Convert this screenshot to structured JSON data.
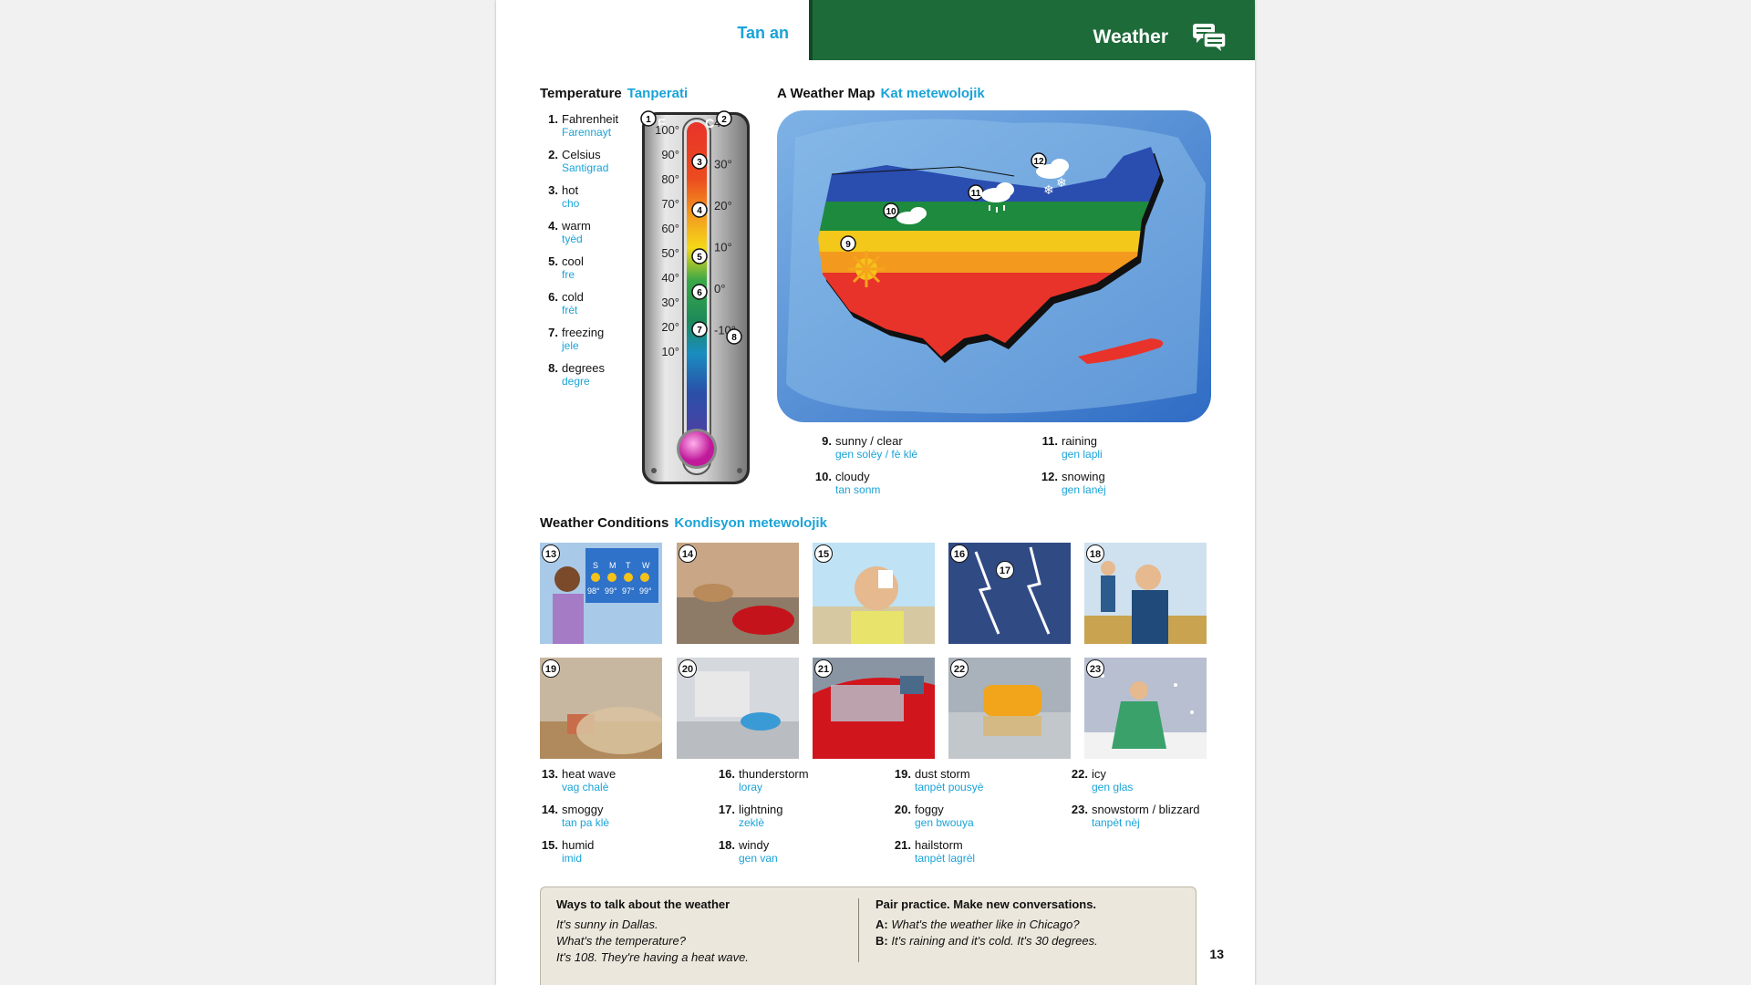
{
  "header": {
    "left_title": "Tan an",
    "right_title": "Weather",
    "icon": "speech-bubble-icon"
  },
  "temperature": {
    "title": "Temperature",
    "title_ht": "Tanperati",
    "items": [
      {
        "num": "1.",
        "en": "Fahrenheit",
        "ht": "Farennayt"
      },
      {
        "num": "2.",
        "en": "Celsius",
        "ht": "Santigrad"
      },
      {
        "num": "3.",
        "en": "hot",
        "ht": "cho"
      },
      {
        "num": "4.",
        "en": "warm",
        "ht": "tyèd"
      },
      {
        "num": "5.",
        "en": "cool",
        "ht": "fre"
      },
      {
        "num": "6.",
        "en": "cold",
        "ht": "frèt"
      },
      {
        "num": "7.",
        "en": "freezing",
        "ht": "jele"
      },
      {
        "num": "8.",
        "en": "degrees",
        "ht": "degre"
      }
    ],
    "thermometer": {
      "f_label": "F",
      "c_label": "C",
      "f_ticks": [
        "100°",
        "90°",
        "80°",
        "70°",
        "60°",
        "50°",
        "40°",
        "30°",
        "20°",
        "10°"
      ],
      "c_ticks": [
        "40°",
        "30°",
        "20°",
        "10°",
        "0°",
        "-10°"
      ],
      "callouts": [
        "1",
        "2",
        "3",
        "4",
        "5",
        "6",
        "7",
        "8"
      ]
    }
  },
  "weather_map": {
    "title": "A Weather Map",
    "title_ht": "Kat metewolojik",
    "callouts": [
      "9",
      "10",
      "11",
      "12"
    ],
    "items": [
      {
        "num": "9.",
        "en": "sunny / clear",
        "ht": "gen solèy / fè klè"
      },
      {
        "num": "10.",
        "en": "cloudy",
        "ht": "tan sonm"
      },
      {
        "num": "11.",
        "en": "raining",
        "ht": "gen lapli"
      },
      {
        "num": "12.",
        "en": "snowing",
        "ht": "gen lanèj"
      }
    ]
  },
  "conditions": {
    "title": "Weather Conditions",
    "title_ht": "Kondisyon metewolojik",
    "forecast_days": [
      "S",
      "M",
      "T",
      "W"
    ],
    "forecast_temps": [
      "98°",
      "99°",
      "97°",
      "99°"
    ],
    "image_numbers": [
      "13",
      "14",
      "15",
      "16",
      "17",
      "18",
      "19",
      "20",
      "21",
      "22",
      "23"
    ],
    "items": [
      {
        "num": "13.",
        "en": "heat wave",
        "ht": "vag chalè"
      },
      {
        "num": "14.",
        "en": "smoggy",
        "ht": "tan pa klè"
      },
      {
        "num": "15.",
        "en": "humid",
        "ht": "imid"
      },
      {
        "num": "16.",
        "en": "thunderstorm",
        "ht": "loray"
      },
      {
        "num": "17.",
        "en": "lightning",
        "ht": "zeklè"
      },
      {
        "num": "18.",
        "en": "windy",
        "ht": "gen van"
      },
      {
        "num": "19.",
        "en": "dust storm",
        "ht": "tanpèt pousyè"
      },
      {
        "num": "20.",
        "en": "foggy",
        "ht": "gen bwouya"
      },
      {
        "num": "21.",
        "en": "hailstorm",
        "ht": "tanpèt lagrèl"
      },
      {
        "num": "22.",
        "en": "icy",
        "ht": "gen glas"
      },
      {
        "num": "23.",
        "en": "snowstorm / blizzard",
        "ht": "tanpèt nèj"
      }
    ]
  },
  "talk_box": {
    "left_title": "Ways to talk about the weather",
    "left_lines": [
      "It's sunny in Dallas.",
      "What's the temperature?",
      "It's 108. They're having a heat wave."
    ],
    "right_title": "Pair practice. Make new conversations.",
    "right_a_label": "A:",
    "right_a": "What's the weather like in Chicago?",
    "right_b_label": "B:",
    "right_b": "It's raining and it's cold. It's 30 degrees."
  },
  "page_number": "13"
}
